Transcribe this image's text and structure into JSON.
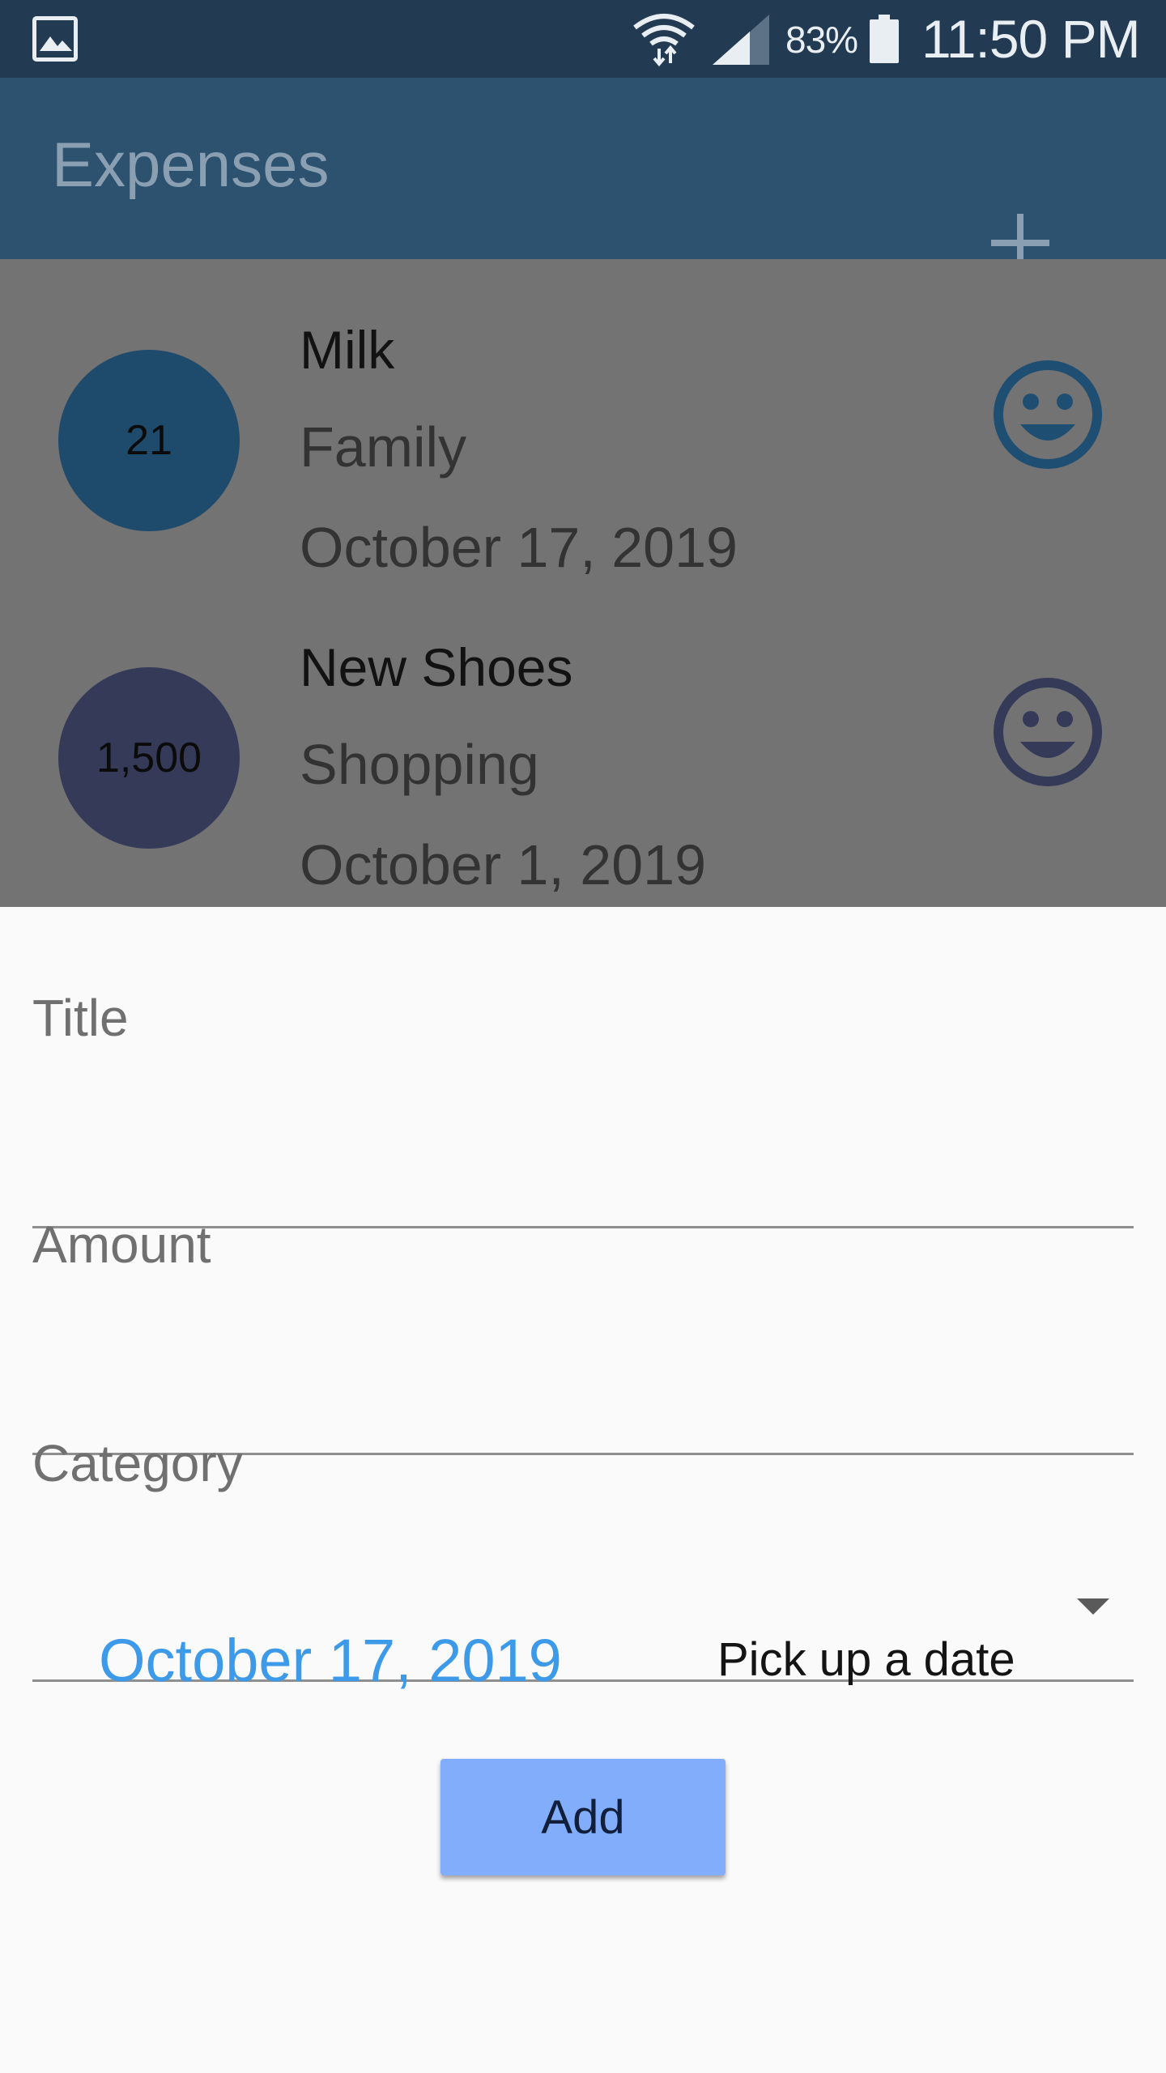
{
  "status_bar": {
    "battery": "83%",
    "time": "11:50 PM"
  },
  "app_bar": {
    "title": "Expenses",
    "add_icon": "plus-icon"
  },
  "expenses": [
    {
      "amount": "21",
      "title": "Milk",
      "category": "Family",
      "date": "October 17, 2019",
      "avatar_color": "#1e4a6c",
      "icon": "smiley-icon",
      "icon_color": "#1f4e73"
    },
    {
      "amount": "1,500",
      "title": "New Shoes",
      "category": "Shopping",
      "date": "October 1, 2019",
      "avatar_color": "#343a58",
      "icon": "smiley-icon",
      "icon_color": "#343a58"
    }
  ],
  "form": {
    "title_label": "Title",
    "amount_label": "Amount",
    "category_label": "Category",
    "selected_date": "October 17, 2019",
    "pick_date_label": "Pick up a date",
    "add_button_label": "Add"
  },
  "colors": {
    "status_bar": "#223b52",
    "app_bar": "#2d5270",
    "scrim": "#737373",
    "date_accent": "#3d9ae8",
    "add_button": "#82adfb"
  }
}
